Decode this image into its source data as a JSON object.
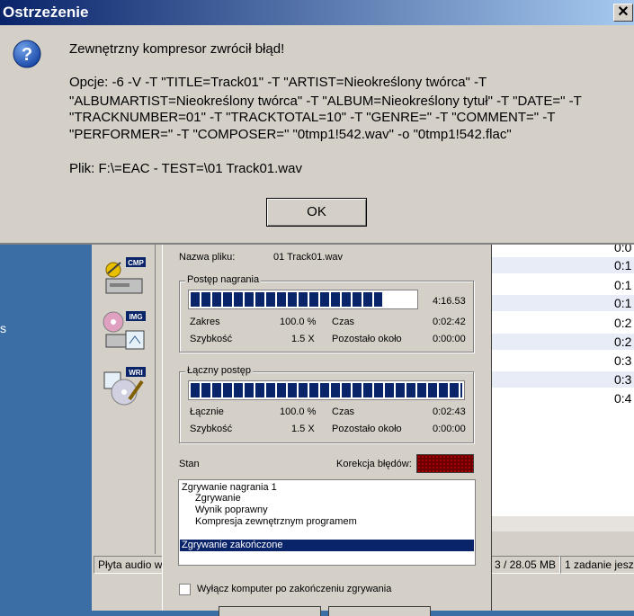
{
  "warning": {
    "title": "Ostrzeżenie",
    "close_glyph": "✕",
    "icon": "question-icon",
    "heading": "Zewnętrzny kompresor zwrócił błąd!",
    "options_lines": [
      "Opcje: -6 -V -T \"TITLE=Track01\" -T \"ARTIST=Nieokreślony twórca\" -T",
      "\"ALBUMARTIST=Nieokreślony twórca\" -T \"ALBUM=Nieokreślony tytuł\" -T \"DATE=\" -T",
      "\"TRACKNUMBER=01\" -T \"TRACKTOTAL=10\" -T \"GENRE=\" -T \"COMMENT=\" -T",
      "\"PERFORMER=\" -T \"COMPOSER=\" \"0tmp1!542.wav\" -o \"0tmp1!542.flac\""
    ],
    "file_line": "Plik: F:\\=EAC - TEST=\\01 Track01.wav",
    "ok_label": "OK"
  },
  "sidebar": {
    "icons": [
      {
        "name": "cmp-icon",
        "label": "CMP"
      },
      {
        "name": "img-icon",
        "label": "IMG"
      },
      {
        "name": "wri-icon",
        "label": "WRI"
      }
    ]
  },
  "tracklist": {
    "values": [
      "0:0",
      "0:1",
      "0:1",
      "0:1",
      "0:2",
      "0:2",
      "0:3",
      "0:3",
      "0:4"
    ]
  },
  "statusbar": {
    "left": "Płyta audio w",
    "size": "3  /  28.05 MB",
    "jobs": "1 zadanie jesz"
  },
  "progress": {
    "filename_label": "Nazwa pliku:",
    "filename": "01 Track01.wav",
    "track_group": "Postęp nagrania",
    "track_time": "4:16.53",
    "track_fill": 0.85,
    "range_label": "Zakres",
    "range_value": "100.0 %",
    "time_label": "Czas",
    "time_value": "0:02:42",
    "speed_label": "Szybkość",
    "speed_value": "1.5 X",
    "remaining_label": "Pozostało około",
    "remaining_value": "0:00:00",
    "total_group": "Łączny postęp",
    "total_fill": 1.0,
    "total_label": "Łącznie",
    "total_value": "100.0 %",
    "total_time_label": "Czas",
    "total_time_value": "0:02:43",
    "total_speed_label": "Szybkość",
    "total_speed_value": "1.5 X",
    "total_remaining_label": "Pozostało około",
    "total_remaining_value": "0:00:00",
    "status_label": "Stan",
    "error_corr_label": "Korekcja błędów:",
    "log": [
      "Zgrywanie nagrania  1",
      "Zgrywanie",
      "Wynik poprawny",
      "Kompresja zewnętrznym programem",
      "Zgrywanie zakończone"
    ],
    "shutdown_label": "Wyłącz komputer po zakończeniu zgrywania"
  }
}
